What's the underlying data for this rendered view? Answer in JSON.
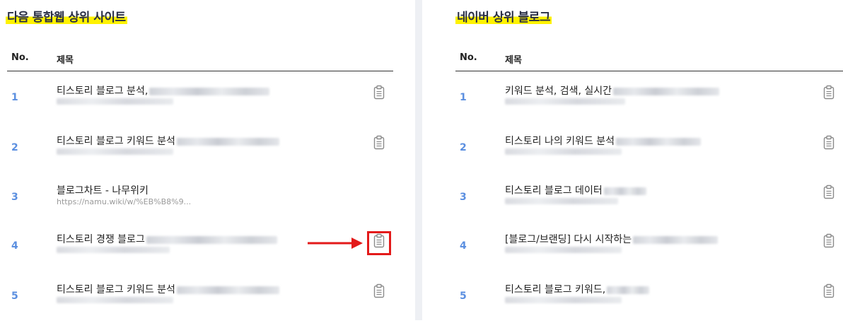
{
  "left_panel": {
    "title": "다음 통합웹 상위 사이트",
    "header": {
      "no": "No.",
      "title": "제목"
    },
    "rows": [
      {
        "rank": "1",
        "title": "티스토리 블로그 분석,",
        "url": ""
      },
      {
        "rank": "2",
        "title": "티스토리 블로그 키워드 분석",
        "url": ""
      },
      {
        "rank": "3",
        "title": "블로그차트 - 나무위키",
        "url": "https://namu.wiki/w/%EB%B8%9..."
      },
      {
        "rank": "4",
        "title": "티스토리 경쟁 블로그",
        "url": ""
      },
      {
        "rank": "5",
        "title": "티스토리 블로그 키워드 분석",
        "url": ""
      }
    ]
  },
  "right_panel": {
    "title": "네이버 상위 블로그",
    "header": {
      "no": "No.",
      "title": "제목"
    },
    "rows": [
      {
        "rank": "1",
        "title": "키워드 분석, 검색, 실시간",
        "url": ""
      },
      {
        "rank": "2",
        "title": "티스토리 나의 키워드 분석",
        "url": ""
      },
      {
        "rank": "3",
        "title": "티스토리 블로그 데이터",
        "url": ""
      },
      {
        "rank": "4",
        "title": "[블로그/브랜딩] 다시 시작하는",
        "url": ""
      },
      {
        "rank": "5",
        "title": "티스토리 블로그 키워드,",
        "url": ""
      }
    ]
  },
  "icons": {
    "copy": "clipboard-icon",
    "annotation_arrow": "right-arrow-icon"
  },
  "colors": {
    "title_highlight": "#fff200",
    "rank": "#5b8fe0",
    "annotation": "#e31a1a"
  }
}
